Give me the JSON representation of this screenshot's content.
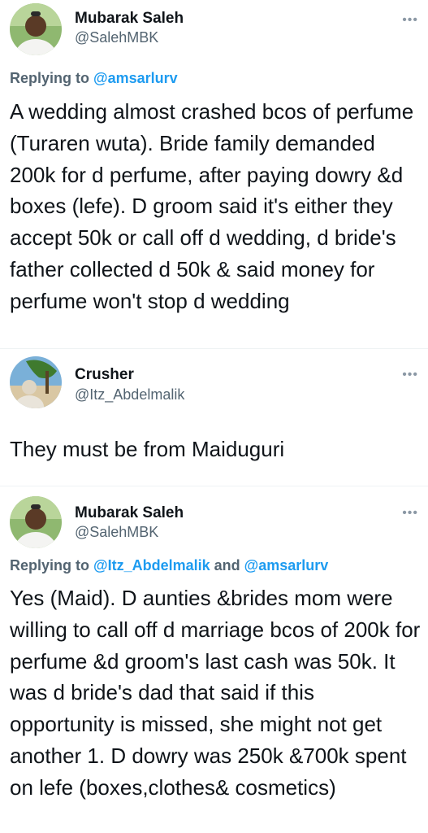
{
  "tweets": [
    {
      "name": "Mubarak Saleh",
      "handle": "@SalehMBK",
      "reply_prefix": "Replying to",
      "reply_to_1": "@amsarlurv",
      "reply_and": "",
      "reply_to_2": "",
      "text": "A wedding almost crashed bcos of perfume (Turaren wuta). Bride family demanded 200k for d perfume, after paying dowry &d boxes (lefe). D groom said it's either they accept 50k or call off d wedding, d bride's father collected d 50k & said money for perfume won't stop d wedding"
    },
    {
      "name": "Crusher",
      "handle": "@Itz_Abdelmalik",
      "text": "They must be from Maiduguri"
    },
    {
      "name": "Mubarak Saleh",
      "handle": "@SalehMBK",
      "reply_prefix": "Replying to",
      "reply_to_1": "@Itz_Abdelmalik",
      "reply_and": "and",
      "reply_to_2": "@amsarlurv",
      "text": "Yes (Maid). D aunties &brides mom were willing to call off d marriage bcos of 200k for perfume &d groom's last cash was 50k. It was d bride's dad that said if this opportunity is missed, she might not get another 1. D dowry was 250k &700k spent on lefe (boxes,clothes& cosmetics)"
    }
  ],
  "icons": {
    "more": "more-horizontal-icon",
    "avatar": "profile-photo"
  },
  "colors": {
    "link": "#1d9bf0",
    "secondary": "#536471",
    "text": "#0f1419"
  }
}
